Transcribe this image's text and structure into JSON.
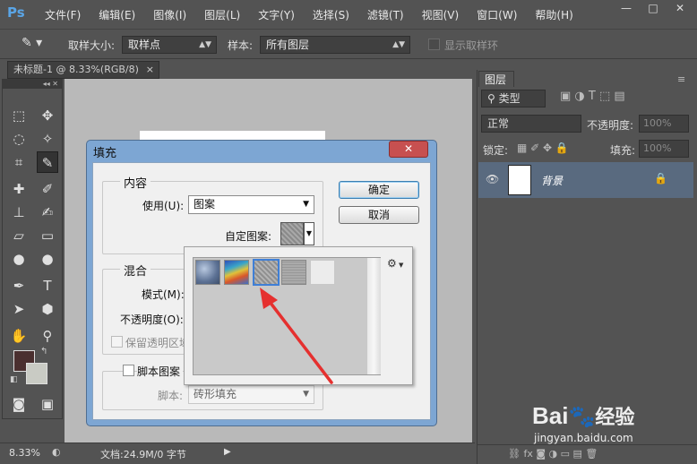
{
  "menubar": {
    "logo": "Ps",
    "items": [
      "文件(F)",
      "编辑(E)",
      "图像(I)",
      "图层(L)",
      "文字(Y)",
      "选择(S)",
      "滤镜(T)",
      "视图(V)",
      "窗口(W)",
      "帮助(H)"
    ],
    "window_controls": [
      "—",
      "□",
      "✕"
    ]
  },
  "options": {
    "sample_size_label": "取样大小:",
    "sample_size_value": "取样点",
    "sample_label": "样本:",
    "sample_value": "所有图层",
    "show_ring_label": "显示取样环"
  },
  "document": {
    "tab_title": "未标题-1 @ 8.33%(RGB/8)",
    "tab_close": "×"
  },
  "statusbar": {
    "zoom": "8.33%",
    "doc_info": "文档:24.9M/0 字节"
  },
  "layers": {
    "tab_label": "图层",
    "kind_label": "类型",
    "blend_mode": "正常",
    "opacity_label": "不透明度:",
    "opacity_value": "100%",
    "lock_label": "锁定:",
    "fill_label": "填充:",
    "fill_value": "100%",
    "layer_name": "背景"
  },
  "dialog": {
    "title": "填充",
    "close": "✕",
    "ok": "确定",
    "cancel": "取消",
    "content_group": "内容",
    "use_label": "使用(U):",
    "use_value": "图案",
    "custom_pattern_label": "自定图案:",
    "blend_group": "混合",
    "mode_label": "模式(M):",
    "opacity_label": "不透明度(O):",
    "preserve_label": "保留透明区域",
    "script_pattern_label": "脚本图案",
    "script_label": "脚本:",
    "script_value": "砖形填充"
  },
  "picker": {
    "gear_icon": "⚙",
    "selected_index": 2
  },
  "watermark": {
    "brand": "Bai",
    "brand_suffix": "经验",
    "url": "jingyan.baidu.com"
  },
  "colors": {
    "ps_blue": "#5aa5e6",
    "layer_selected": "#596a7f",
    "arrow_red": "#e5302f",
    "foreground": "#4a2f2f",
    "background": "#c9cbc4"
  }
}
